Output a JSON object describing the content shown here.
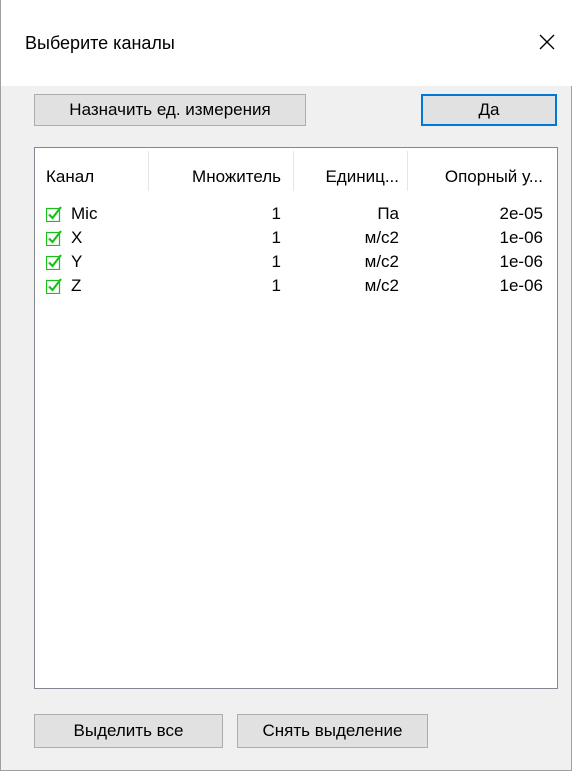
{
  "window": {
    "title": "Выберите каналы"
  },
  "toolbar": {
    "assign_units_label": "Назначить ед. измерения",
    "ok_label": "Да"
  },
  "table": {
    "columns": [
      "Канал",
      "Множитель",
      "Единиц...",
      "Опорный у..."
    ],
    "rows": [
      {
        "checked": true,
        "channel": "Mic",
        "multiplier": "1",
        "unit": "Па",
        "reference": "2e-05"
      },
      {
        "checked": true,
        "channel": "X",
        "multiplier": "1",
        "unit": "м/с2",
        "reference": "1e-06"
      },
      {
        "checked": true,
        "channel": "Y",
        "multiplier": "1",
        "unit": "м/с2",
        "reference": "1e-06"
      },
      {
        "checked": true,
        "channel": "Z",
        "multiplier": "1",
        "unit": "м/с2",
        "reference": "1e-06"
      }
    ]
  },
  "footer": {
    "select_all_label": "Выделить все",
    "deselect_label": "Снять выделение"
  },
  "colors": {
    "check_mark": "#17c217",
    "default_button_border": "#0078d7"
  },
  "icons": {
    "close": "close-icon",
    "checkbox": "checkbox-checked-icon"
  }
}
